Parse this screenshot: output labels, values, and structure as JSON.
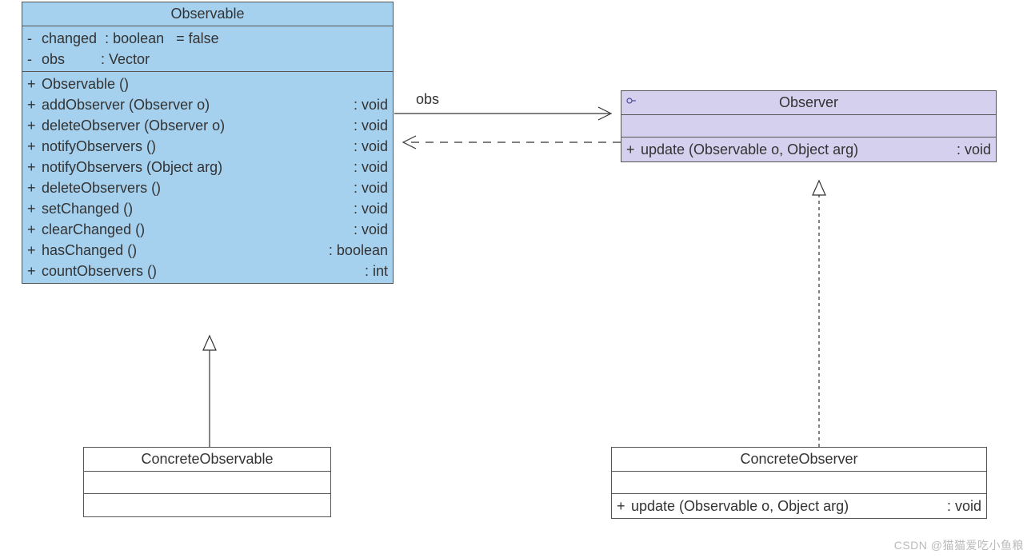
{
  "observable": {
    "name": "Observable",
    "attributes": [
      {
        "visibility": "-",
        "name": "changed",
        "type": "boolean",
        "default": "false"
      },
      {
        "visibility": "-",
        "name": "obs",
        "type": "Vector",
        "default": null
      }
    ],
    "operations": [
      {
        "visibility": "+",
        "signature": "Observable ()",
        "returns": null
      },
      {
        "visibility": "+",
        "signature": "addObserver (Observer o)",
        "returns": "void"
      },
      {
        "visibility": "+",
        "signature": "deleteObserver (Observer o)",
        "returns": "void"
      },
      {
        "visibility": "+",
        "signature": "notifyObservers ()",
        "returns": "void"
      },
      {
        "visibility": "+",
        "signature": "notifyObservers (Object arg)",
        "returns": "void"
      },
      {
        "visibility": "+",
        "signature": "deleteObservers ()",
        "returns": "void"
      },
      {
        "visibility": "+",
        "signature": "setChanged ()",
        "returns": "void"
      },
      {
        "visibility": "+",
        "signature": "clearChanged ()",
        "returns": "void"
      },
      {
        "visibility": "+",
        "signature": "hasChanged ()",
        "returns": "boolean"
      },
      {
        "visibility": "+",
        "signature": "countObservers ()",
        "returns": "int"
      }
    ]
  },
  "observer": {
    "name": "Observer",
    "is_interface": true,
    "operations": [
      {
        "visibility": "+",
        "signature": "update (Observable o, Object arg)",
        "returns": "void"
      }
    ]
  },
  "concrete_observable": {
    "name": "ConcreteObservable"
  },
  "concrete_observer": {
    "name": "ConcreteObserver",
    "operations": [
      {
        "visibility": "+",
        "signature": "update (Observable o, Object arg)",
        "returns": "void"
      }
    ]
  },
  "association_label": "obs",
  "watermark": "CSDN @猫猫爱吃小鱼粮"
}
